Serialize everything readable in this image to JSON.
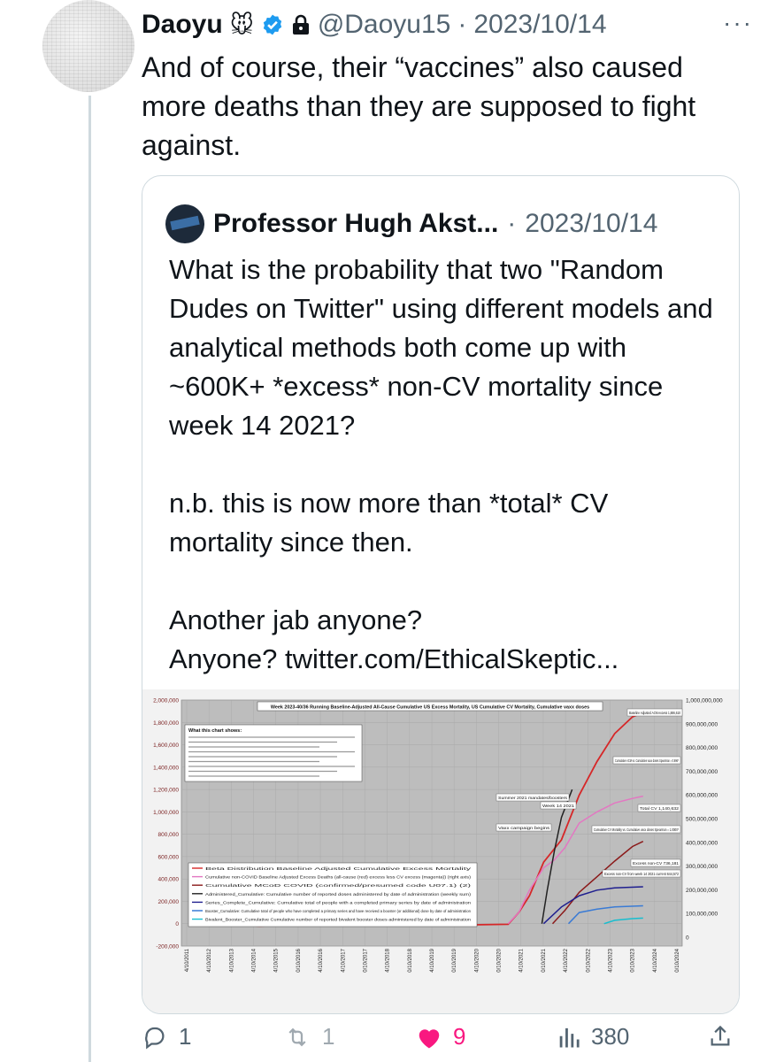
{
  "post": {
    "author_name": "Daoyu",
    "author_emoji": "🐭",
    "handle": "@Daoyu15",
    "separator": "·",
    "date": "2023/10/14",
    "more": "···",
    "text": "And of course, their “vaccines” also caused more deaths than they are supposed to fight against."
  },
  "quote": {
    "author_name": "Professor Hugh Akst...",
    "separator": "·",
    "date": "2023/10/14",
    "text": "What is the probability that two \"Random Dudes on Twitter\" using different models and analytical methods both come up with ~600K+ *excess* non-CV mortality since week 14 2021?\n\nn.b. this is now more than *total* CV mortality since then.\n\nAnother jab anyone?\nAnyone? twitter.com/EthicalSkeptic..."
  },
  "chart_data": {
    "type": "line",
    "title": "Week 2023-40/36 Running Baseline-Adjusted All-Cause Cumulative US Excess Mortality, US Cumulative CV Mortality, Cumulative vaxx doses",
    "y_left_ticks": [
      "2,000,000",
      "1,800,000",
      "1,600,000",
      "1,400,000",
      "1,200,000",
      "1,000,000",
      "800,000",
      "600,000",
      "400,000",
      "200,000",
      "0",
      "-200,000"
    ],
    "y_right_ticks": [
      "1,000,000,000",
      "900,000,000",
      "800,000,000",
      "700,000,000",
      "600,000,000",
      "500,000,000",
      "400,000,000",
      "300,000,000",
      "200,000,000",
      "100,000,000",
      "0"
    ],
    "x_ticks": [
      "4/10/2011",
      "4/10/2012",
      "4/10/2013",
      "4/10/2014",
      "4/10/2015",
      "0/10/2016",
      "4/10/2016",
      "4/10/2017",
      "0/10/2017",
      "4/10/2018",
      "0/10/2018",
      "4/10/2019",
      "0/10/2019",
      "4/10/2020",
      "0/10/2020",
      "4/10/2021",
      "0/10/2021",
      "4/10/2022",
      "0/10/2022",
      "4/10/2023",
      "0/10/2023",
      "4/10/2024",
      "0/10/2024"
    ],
    "ylim_left": [
      -200000,
      2000000
    ],
    "ylim_right": [
      0,
      1000000000
    ],
    "grid": true,
    "annotations": [
      "What this chart shows:",
      "Summer 2021 mandates/boosters",
      "Week 14 2021",
      "Vaxx campaign begins",
      "Baseline Adjusted ACM excess 1,886,610",
      "Cumulative ACM vs. Cumulative vaxx doses Spearman = 0.996*",
      "Total CV 1,140,632",
      "Cumulative CV Mortality vs. Cumulative vaxx doses Spearman = 1.0000*",
      "Excess non-CV 736,181",
      "Excess non-CV from week 14 2021 current 644,572"
    ],
    "legend": [
      "Beta Distribution Baseline Adjusted Cumulative Excess Mortality",
      "Cumulative non-COVID Baseline Adjusted Excess Deaths (all-cause (red) excess less CV excess (magenta)) (right axis)",
      "Cumulative MCoD COVID (confirmed/presumed code U07.1) (2)",
      "Administered_Cumulative: Cumulative number of reported doses administered by date of administration (weekly sum)",
      "Series_Complete_Cumulative: Cumulative total of people with a completed primary series by date of administration",
      "Booster_Cumulative: Cumulative total of people who have completed a primary series and have received a booster (or additional) dose by date of administration",
      "Bivalent_Booster_Cumulative Cumulative number of reported bivalent booster doses administered by date of administration"
    ],
    "series": [
      {
        "name": "Beta Distribution Baseline Adjusted Cumulative Excess Mortality",
        "color": "#d62728",
        "x": [
          2011,
          2013,
          2015,
          2017,
          2019,
          2020,
          2020.3,
          2020.6,
          2021,
          2021.5,
          2022,
          2022.5,
          2023,
          2023.5,
          2023.8
        ],
        "values": [
          10000,
          -20000,
          5000,
          -15000,
          -10000,
          -5000,
          100000,
          250000,
          550000,
          750000,
          1150000,
          1450000,
          1700000,
          1850000,
          1886610
        ]
      },
      {
        "name": "Cumulative MCoD COVID (confirmed/presumed code U07.1) (2)",
        "color": "#e377c2",
        "x": [
          2020,
          2020.3,
          2020.6,
          2021,
          2021.3,
          2021.6,
          2022,
          2022.5,
          2023,
          2023.5,
          2023.8
        ],
        "values": [
          0,
          100000,
          300000,
          500000,
          570000,
          680000,
          900000,
          1000000,
          1080000,
          1120000,
          1140632
        ]
      },
      {
        "name": "Cumulative non-COVID Baseline Adjusted Excess Deaths (all-cause (red) excess less CV excess (magenta)) (right axis)",
        "color": "#8b1a1a",
        "x": [
          2021.25,
          2021.6,
          2022,
          2022.5,
          2023,
          2023.5,
          2023.8
        ],
        "values": [
          0,
          120000,
          280000,
          420000,
          560000,
          690000,
          736181
        ]
      },
      {
        "name": "Administered_Cumulative: Cumulative number of reported doses administered by date of administration (weekly sum)",
        "color": "#222222",
        "x": [
          2020.95,
          2021.1,
          2021.3,
          2021.5,
          2021.8
        ],
        "values": [
          0,
          300000,
          650000,
          950000,
          1200000
        ]
      },
      {
        "name": "Series_Complete_Cumulative: Cumulative total of people with a completed primary series by date of administration",
        "color": "#1f1f8f",
        "x": [
          2021,
          2021.5,
          2022,
          2022.5,
          2023,
          2023.8
        ],
        "values": [
          0,
          150000,
          250000,
          300000,
          320000,
          330000
        ]
      },
      {
        "name": "Booster_Cumulative: Cumulative total of people who have completed a primary series and have received a booster (or additional) dose by date of administration",
        "color": "#3a7bd5",
        "x": [
          2021.7,
          2022,
          2022.5,
          2023,
          2023.8
        ],
        "values": [
          0,
          100000,
          130000,
          150000,
          160000
        ]
      },
      {
        "name": "Bivalent_Booster_Cumulative Cumulative number of reported bivalent booster doses administered by date of administration",
        "color": "#17becf",
        "x": [
          2022.7,
          2023,
          2023.5,
          2023.8
        ],
        "values": [
          0,
          30000,
          45000,
          50000
        ]
      }
    ]
  },
  "actions": {
    "reply_count": "1",
    "retweet_count": "1",
    "like_count": "9",
    "view_count": "380"
  }
}
